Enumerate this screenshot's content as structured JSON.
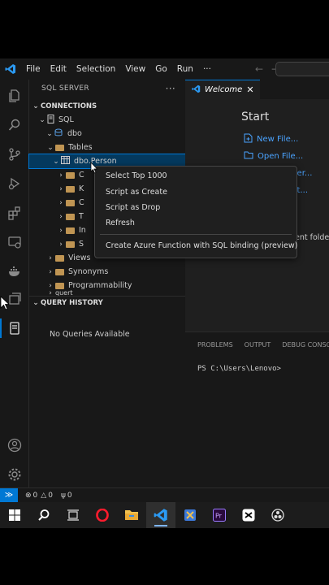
{
  "menu": [
    "File",
    "Edit",
    "Selection",
    "View",
    "Go",
    "Run",
    "···"
  ],
  "sidebar": {
    "title": "SQL SERVER",
    "more": "···",
    "connections_label": "CONNECTIONS",
    "tree": {
      "server": "SQL",
      "schema": "dbo",
      "tables": "Tables",
      "selected_table": "dbo.Person",
      "children": [
        "C",
        "K",
        "C",
        "T",
        "In",
        "S"
      ],
      "views": "Views",
      "synonyms": "Synonyms",
      "programmability": "Programmability",
      "cut_item": "quert"
    },
    "query_history_label": "QUERY HISTORY",
    "no_queries": "No Queries Available"
  },
  "editor": {
    "tab_label": "Welcome",
    "start_heading": "Start",
    "links": [
      "New File...",
      "Open File...",
      "...er...",
      "...t..."
    ],
    "recent_cut": "ent folder"
  },
  "panel": {
    "tabs": [
      "PROBLEMS",
      "OUTPUT",
      "DEBUG CONSO"
    ],
    "prompt": "PS C:\\Users\\Lenovo>"
  },
  "context_menu": {
    "items": [
      "Select Top 1000",
      "Script as Create",
      "Script as Drop",
      "Refresh"
    ],
    "azure": "Create Azure Function with SQL binding (preview)"
  },
  "status": {
    "errors": "0",
    "warnings": "0",
    "ports": "0"
  },
  "colors": {
    "accent": "#0078d4",
    "link": "#4aa3ff",
    "folder": "#c09553"
  }
}
